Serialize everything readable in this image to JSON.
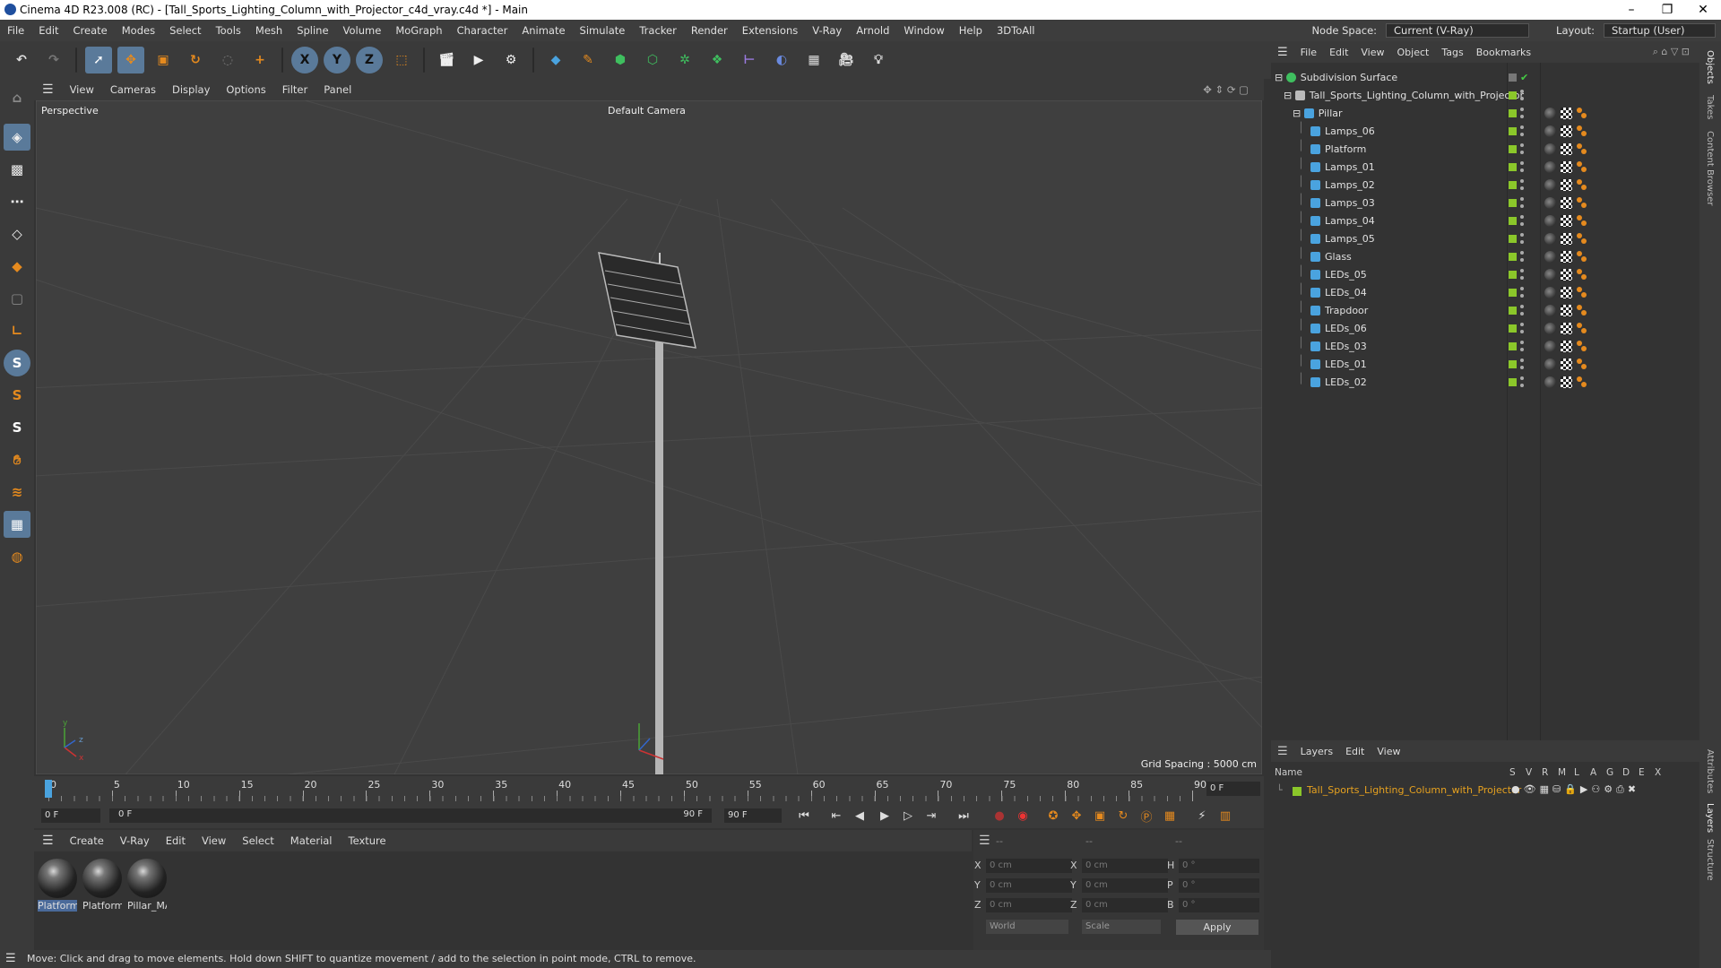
{
  "window": {
    "title": "Cinema 4D R23.008 (RC) - [Tall_Sports_Lighting_Column_with_Projector_c4d_vray.c4d *] - Main"
  },
  "menu": [
    "File",
    "Edit",
    "Create",
    "Modes",
    "Select",
    "Tools",
    "Mesh",
    "Spline",
    "Volume",
    "MoGraph",
    "Character",
    "Animate",
    "Simulate",
    "Tracker",
    "Render",
    "Extensions",
    "V-Ray",
    "Arnold",
    "Window",
    "Help",
    "3DToAll"
  ],
  "nodespace": {
    "label": "Node Space:",
    "value": "Current (V-Ray)"
  },
  "layout": {
    "label": "Layout:",
    "value": "Startup (User)"
  },
  "viewport": {
    "menu": [
      "View",
      "Cameras",
      "Display",
      "Options",
      "Filter",
      "Panel"
    ],
    "name": "Perspective",
    "camera": "Default Camera",
    "grid_spacing": "Grid Spacing : 5000 cm"
  },
  "timeline": {
    "ticks": [
      "0",
      "5",
      "10",
      "15",
      "20",
      "25",
      "30",
      "35",
      "40",
      "45",
      "50",
      "55",
      "60",
      "65",
      "70",
      "75",
      "80",
      "85",
      "90"
    ],
    "current_frame": "0 F",
    "start": "0 F",
    "range_start": "0 F",
    "range_end": "90 F",
    "end": "90 F"
  },
  "material_manager": {
    "menu": [
      "Create",
      "V-Ray",
      "Edit",
      "View",
      "Select",
      "Material",
      "Texture"
    ],
    "materials": [
      "Platform",
      "Platform",
      "Pillar_MA"
    ]
  },
  "coords": {
    "headers": [
      "--",
      "--",
      "--"
    ],
    "pos": [
      {
        "axis": "X",
        "value": "0 cm"
      },
      {
        "axis": "Y",
        "value": "0 cm"
      },
      {
        "axis": "Z",
        "value": "0 cm"
      }
    ],
    "size": [
      {
        "axis": "X",
        "value": "0 cm"
      },
      {
        "axis": "Y",
        "value": "0 cm"
      },
      {
        "axis": "Z",
        "value": "0 cm"
      }
    ],
    "rot": [
      {
        "axis": "H",
        "value": "0 °"
      },
      {
        "axis": "P",
        "value": "0 °"
      },
      {
        "axis": "B",
        "value": "0 °"
      }
    ],
    "world": "World",
    "scale": "Scale",
    "apply": "Apply"
  },
  "objects": {
    "menu": [
      "File",
      "Edit",
      "View",
      "Object",
      "Tags",
      "Bookmarks"
    ],
    "root": "Subdivision Surface",
    "group": "Tall_Sports_Lighting_Column_with_Projector",
    "pillar": "Pillar",
    "children": [
      "Lamps_06",
      "Platform",
      "Lamps_01",
      "Lamps_02",
      "Lamps_03",
      "Lamps_04",
      "Lamps_05",
      "Glass",
      "LEDs_05",
      "LEDs_04",
      "Trapdoor",
      "LEDs_06",
      "LEDs_03",
      "LEDs_01",
      "LEDs_02"
    ]
  },
  "layers": {
    "menu": [
      "Layers",
      "Edit",
      "View"
    ],
    "name_header": "Name",
    "cols": [
      "S",
      "V",
      "R",
      "M",
      "L",
      "A",
      "G",
      "D",
      "E",
      "X"
    ],
    "layer": "Tall_Sports_Lighting_Column_with_Projector"
  },
  "right_tabs": [
    "Objects",
    "Takes",
    "Content Browser",
    "Attributes",
    "Layers",
    "Structure"
  ],
  "status": "Move: Click and drag to move elements. Hold down SHIFT to quantize movement / add to the selection in point mode, CTRL to remove.",
  "colors": {
    "accent": "#4aa3df",
    "green": "#8bc72a",
    "orange": "#e58a1e",
    "layer_text": "#e6a11f"
  }
}
